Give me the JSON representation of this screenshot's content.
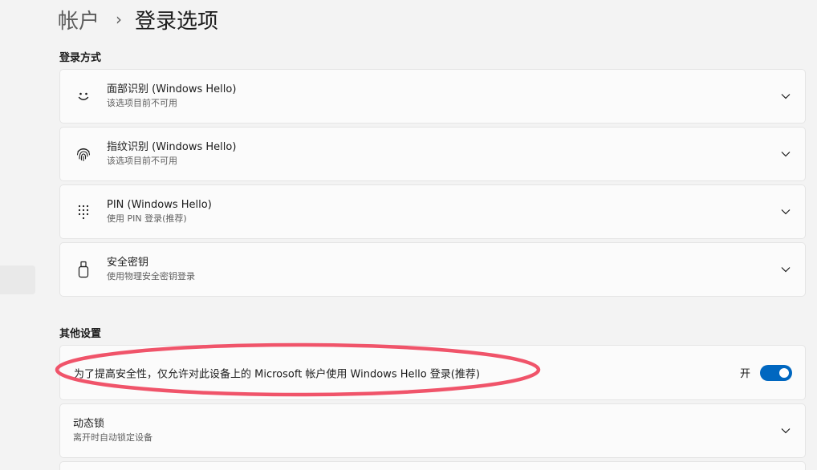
{
  "breadcrumb": {
    "parent": "帐户",
    "separator": "›",
    "current": "登录选项"
  },
  "sections": {
    "sign_in_methods": "登录方式",
    "other_settings": "其他设置"
  },
  "sign_in_methods": [
    {
      "icon": "smiley-face-icon",
      "title": "面部识别 (Windows Hello)",
      "subtitle": "该选项目前不可用"
    },
    {
      "icon": "fingerprint-icon",
      "title": "指纹识别 (Windows Hello)",
      "subtitle": "该选项目前不可用"
    },
    {
      "icon": "keypad-icon",
      "title": "PIN (Windows Hello)",
      "subtitle": "使用 PIN 登录(推荐)"
    },
    {
      "icon": "usb-key-icon",
      "title": "安全密钥",
      "subtitle": "使用物理安全密钥登录"
    }
  ],
  "other_settings": {
    "hello_only": {
      "label": "为了提高安全性，仅允许对此设备上的 Microsoft 帐户使用 Windows Hello 登录(推荐)",
      "toggle_state_label": "开",
      "toggle_on": true
    },
    "dynamic_lock": {
      "title": "动态锁",
      "subtitle": "离开时自动锁定设备"
    }
  },
  "colors": {
    "accent": "#0067c0",
    "annotation": "#f0546a",
    "background": "#f3f3f3",
    "card": "#fbfbfb"
  }
}
